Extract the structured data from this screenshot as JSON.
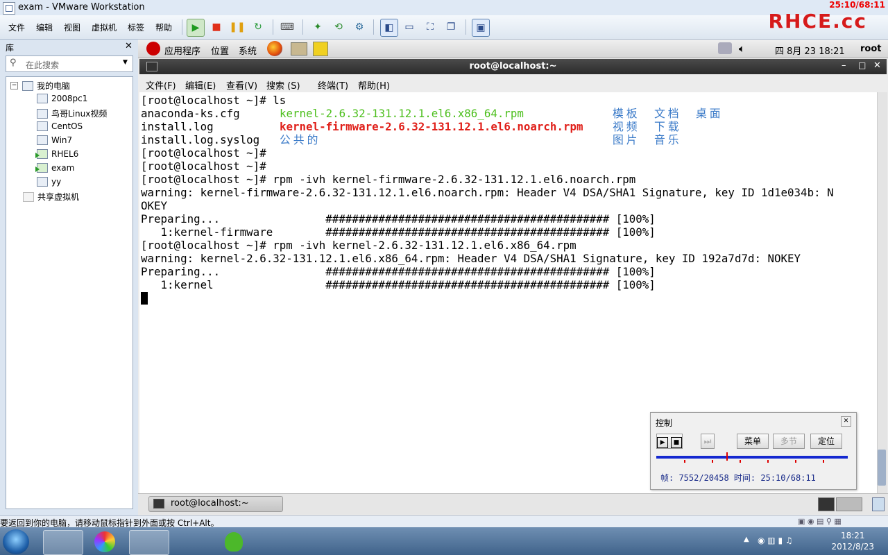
{
  "window": {
    "title": "exam - VMware Workstation",
    "rec_time": "25:10/68:11"
  },
  "brand": {
    "logo_text": "RHCE.cc"
  },
  "vm_menu": [
    "文件",
    "编辑",
    "视图",
    "虚拟机",
    "标签",
    "帮助"
  ],
  "library": {
    "header": "库",
    "search_placeholder": "在此搜索",
    "root": "我的电脑",
    "vms": [
      "2008pc1",
      "鸟哥Linux视频",
      "CentOS",
      "Win7",
      "RHEL6",
      "exam",
      "yy"
    ],
    "shared": "共享虚拟机"
  },
  "gnome_panel": {
    "apps": "应用程序",
    "places": "位置",
    "system": "系统",
    "datetime": "四 8月 23 18:21",
    "user": "root"
  },
  "terminal": {
    "title": "root@localhost:~",
    "menu": [
      "文件(F)",
      "编辑(E)",
      "查看(V)",
      "搜索 (S)",
      "终端(T)",
      "帮助(H)"
    ],
    "lines": [
      "[root@localhost ~]# ls",
      "",
      "",
      "",
      "[root@localhost ~]#",
      "[root@localhost ~]#",
      "[root@localhost ~]# rpm -ivh kernel-firmware-2.6.32-131.12.1.el6.noarch.rpm",
      "warning: kernel-firmware-2.6.32-131.12.1.el6.noarch.rpm: Header V4 DSA/SHA1 Signature, key ID 1d1e034b: N",
      "OKEY",
      "Preparing...                ########################################### [100%]",
      "   1:kernel-firmware        ########################################### [100%]",
      "[root@localhost ~]# rpm -ivh kernel-2.6.32-131.12.1.el6.x86_64.rpm",
      "warning: kernel-2.6.32-131.12.1.el6.x86_64.rpm: Header V4 DSA/SHA1 Signature, key ID 192a7d7d: NOKEY",
      "Preparing...                ########################################### [100%]",
      "   1:kernel                 ########################################### [100%]"
    ],
    "ls_output": {
      "col1": [
        "anaconda-ks.cfg",
        "install.log",
        "install.log.syslog"
      ],
      "col2": [
        "kernel-2.6.32-131.12.1.el6.x86_64.rpm",
        "kernel-firmware-2.6.32-131.12.1.el6.noarch.rpm",
        "公共的"
      ],
      "col3": [
        "模板",
        "视频",
        "图片"
      ],
      "col4": [
        "文档",
        "下载",
        "音乐"
      ],
      "col5": [
        "桌面"
      ]
    },
    "taskbar_label": "root@localhost:~"
  },
  "control": {
    "title": "控制",
    "menu_btn": "菜单",
    "chapter_btn": "多节",
    "locate_btn": "定位",
    "info": "帧: 7552/20458 时间: 25:10/68:11"
  },
  "status_bar": "要返回到你的电脑，请移动鼠标指针到外面或按 Ctrl+Alt。",
  "clock": {
    "time": "18:21",
    "date": "2012/8/23"
  }
}
